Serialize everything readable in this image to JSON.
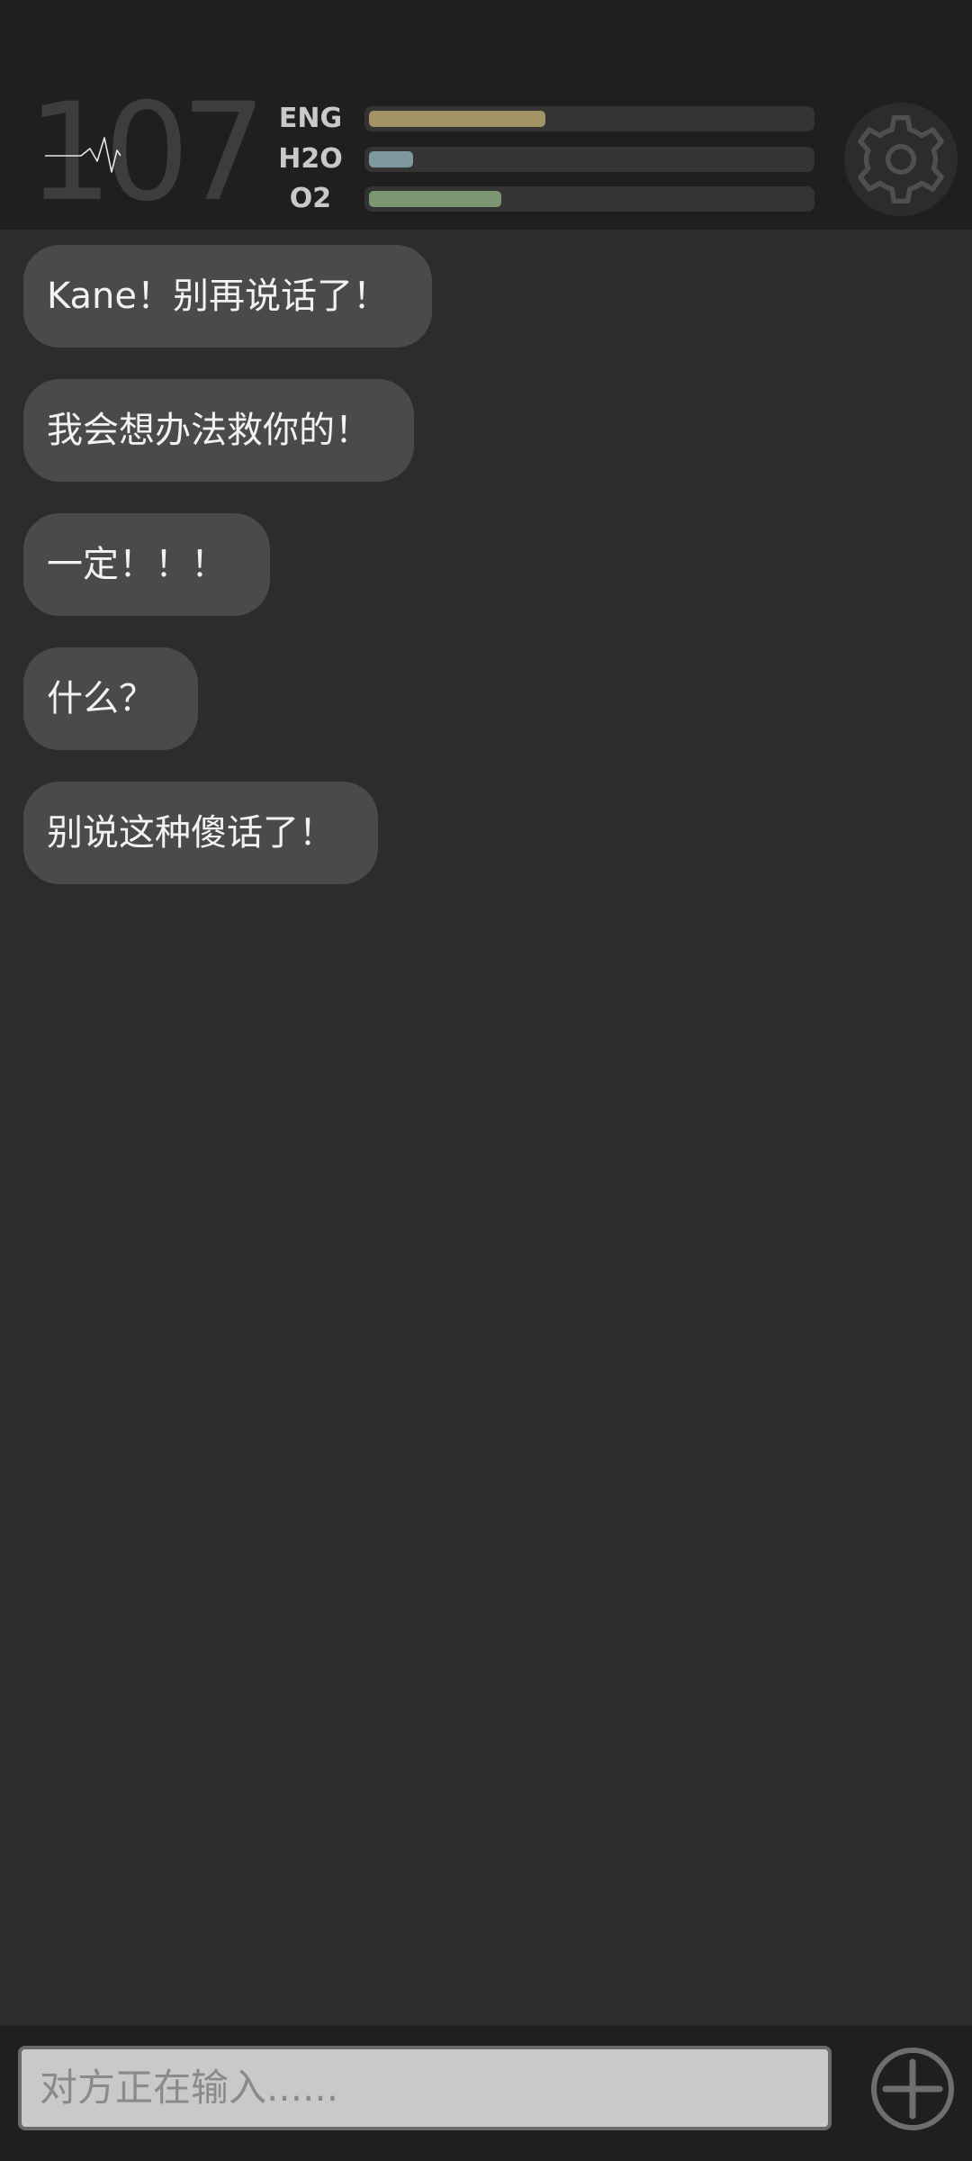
{
  "status": {
    "heart_rate": "107",
    "bars": [
      {
        "label": "ENG",
        "value_percent": 40,
        "color": "#a39466"
      },
      {
        "label": "H2O",
        "value_percent": 10,
        "color": "#7f97a1"
      },
      {
        "label": "O2",
        "value_percent": 30,
        "color": "#7b9670"
      }
    ]
  },
  "settings": {
    "icon": "gear-icon"
  },
  "messages": [
    {
      "text": "Kane！别再说话了！"
    },
    {
      "text": "我会想办法救你的！"
    },
    {
      "text": "一定！！！"
    },
    {
      "text": "什么？"
    },
    {
      "text": "别说这种傻话了！"
    }
  ],
  "input": {
    "placeholder": "对方正在输入......"
  },
  "add_button": {
    "icon": "plus-circle-icon"
  },
  "colors": {
    "background": "#2c2c2c",
    "header_background": "#1f1f1f",
    "bubble": "#4a4a4a",
    "input_background": "#c9c9c9"
  }
}
